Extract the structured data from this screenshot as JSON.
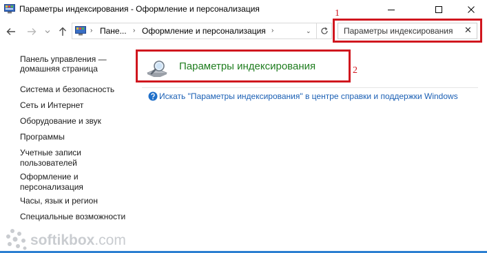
{
  "window": {
    "title": "Параметры индексирования - Оформление и персонализация"
  },
  "navigation": {
    "breadcrumbs": [
      "Пане...",
      "Оформление и персонализация"
    ],
    "search_value": "Параметры индексирования"
  },
  "annotations": {
    "marker_1": "1",
    "marker_2": "2"
  },
  "sidebar": {
    "home_line1": "Панель управления —",
    "home_line2": "домашняя страница",
    "items": [
      "Система и безопасность",
      "Сеть и Интернет",
      "Оборудование и звук",
      "Программы",
      "Учетные записи",
      "пользователей",
      "Оформление и",
      "персонализация",
      "Часы, язык и регион",
      "Специальные возможности"
    ]
  },
  "main": {
    "result_title": "Параметры индексирования",
    "help_link": "Искать \"Параметры индексирования\" в центре справки и поддержки Windows"
  },
  "watermark": {
    "text_bold": "softikbox",
    "text_light": ".com"
  },
  "colors": {
    "highlight_border": "#d0161e",
    "result_title": "#1f7d1f",
    "link": "#1a5fb4",
    "taskbar": "#2c7fd1"
  },
  "icons": {
    "app": "control-panel-icon",
    "back": "arrow-left-icon",
    "forward": "arrow-right-icon",
    "recent": "chevron-down-icon",
    "up": "arrow-up-icon",
    "refresh": "refresh-icon",
    "clear": "close-icon",
    "result": "indexing-options-icon",
    "help": "help-icon"
  }
}
